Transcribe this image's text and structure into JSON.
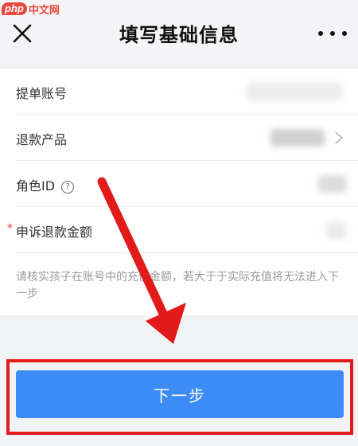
{
  "watermark": {
    "badge": "php",
    "text": "中文网"
  },
  "header": {
    "title": "填写基础信息",
    "close_icon": "close-icon",
    "more_icon": "more-icon"
  },
  "form": {
    "rows": [
      {
        "label": "提单账号"
      },
      {
        "label": "退款产品"
      },
      {
        "label": "角色ID",
        "help": "?"
      },
      {
        "label": "申诉退款金额",
        "required": "*"
      }
    ],
    "hint": "请核实孩子在账号中的充值金额，若大于于实际充值将无法进入下一步"
  },
  "footer": {
    "next_label": "下一步"
  },
  "colors": {
    "accent": "#3d8bf5",
    "annotation": "#e31a1a"
  }
}
